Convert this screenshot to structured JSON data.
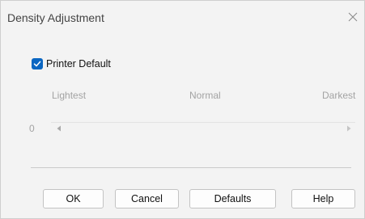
{
  "window": {
    "title": "Density Adjustment",
    "close_icon": "close-icon"
  },
  "printer_default": {
    "label": "Printer Default",
    "checked": true,
    "check_color": "#0a66c2"
  },
  "slider": {
    "labels": {
      "lightest": "Lightest",
      "normal": "Normal",
      "darkest": "Darkest"
    },
    "value_text": "0",
    "enabled": false,
    "left_arrow_icon": "arrow-left-icon",
    "right_arrow_icon": "arrow-right-icon"
  },
  "buttons": {
    "ok": "OK",
    "cancel": "Cancel",
    "defaults": "Defaults",
    "help": "Help"
  }
}
